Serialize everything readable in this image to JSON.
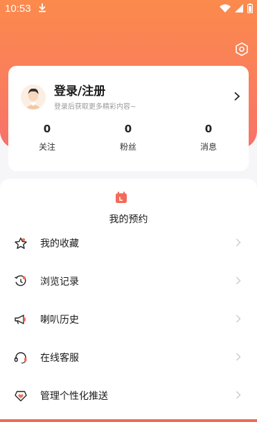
{
  "statusbar": {
    "time": "10:53"
  },
  "profile": {
    "title": "登录/注册",
    "subtitle": "登录后获取更多精彩内容~",
    "stats": [
      {
        "value": "0",
        "label": "关注"
      },
      {
        "value": "0",
        "label": "粉丝"
      },
      {
        "value": "0",
        "label": "消息"
      }
    ]
  },
  "main": {
    "section_title": "我的预约",
    "menu": [
      {
        "label": "我的收藏",
        "icon": "star-icon"
      },
      {
        "label": "浏览记录",
        "icon": "history-icon"
      },
      {
        "label": "喇叭历史",
        "icon": "megaphone-icon"
      },
      {
        "label": "在线客服",
        "icon": "headset-icon"
      },
      {
        "label": "管理个性化推送",
        "icon": "heart-shield-icon"
      }
    ]
  },
  "colors": {
    "accent": "#f7735f",
    "header_top": "#fb8a4c",
    "header_bottom": "#f6726a"
  }
}
